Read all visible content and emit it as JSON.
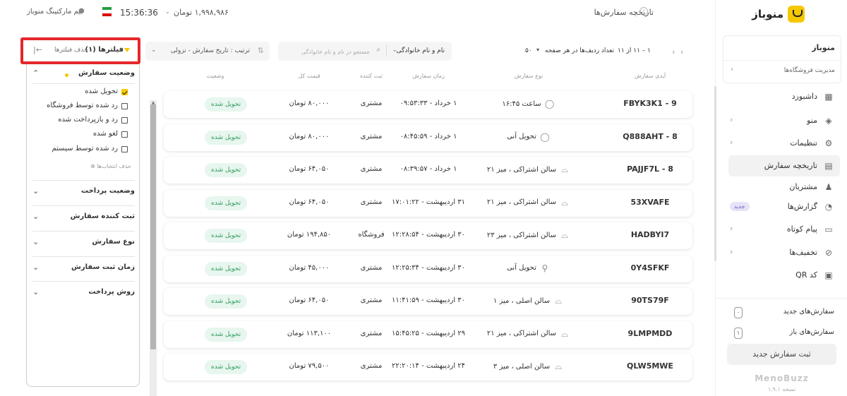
{
  "topbar": {
    "page_title": "تاریخچه سفارش‌ها",
    "balance": "۱,۹۹۸,۹۸۶ تومان",
    "clock": "15:36:36",
    "user": "تیم مارکتینگ منوباز"
  },
  "sidebar": {
    "brand": "منوباز",
    "shop_name": "منوباز",
    "shop_manage": "مدیریت فروشگاه‌ها",
    "items": [
      {
        "label": "داشبورد",
        "icon": "dashboard-icon",
        "glyph": "▦",
        "chevron": false
      },
      {
        "label": "منو",
        "icon": "layers-icon",
        "glyph": "◈",
        "chevron": true
      },
      {
        "label": "تنظیمات",
        "icon": "gear-icon",
        "glyph": "⚙",
        "chevron": true
      },
      {
        "label": "تاریخچه سفارش",
        "icon": "receipt-icon",
        "glyph": "▤",
        "chevron": false,
        "active": true
      },
      {
        "label": "مشتریان",
        "icon": "users-icon",
        "glyph": "♟",
        "chevron": false
      },
      {
        "label": "گزارش‌ها",
        "icon": "chart-icon",
        "glyph": "◔",
        "chevron": false,
        "badge": "جدید"
      },
      {
        "label": "پیام کوتاه",
        "icon": "message-icon",
        "glyph": "▭",
        "chevron": true
      },
      {
        "label": "تخفیف‌ها",
        "icon": "discount-icon",
        "glyph": "⊘",
        "chevron": true
      },
      {
        "label": "کد QR",
        "icon": "qr-icon",
        "glyph": "▣",
        "chevron": false
      }
    ],
    "new_orders_label": "سفارش‌های جدید",
    "new_orders_count": "۰",
    "open_orders_label": "سفارش‌های باز",
    "open_orders_count": "۱",
    "new_order_button": "ثبت سفارش جدید",
    "footer_brand": "MenoBuzz",
    "version": "نسخه ۱.۹.۱"
  },
  "filters": {
    "title": "فیلترها (۱)",
    "clear_all": "حذف فیلترها",
    "sections": [
      {
        "title": "وضعیت سفارش",
        "expanded": true,
        "options": [
          {
            "label": "تحویل شده",
            "checked": true
          },
          {
            "label": "رد شده توسط فروشگاه",
            "checked": false
          },
          {
            "label": "رد و بازپرداخت شده",
            "checked": false
          },
          {
            "label": "لغو شده",
            "checked": false
          },
          {
            "label": "رد شده توسط سیستم",
            "checked": false
          }
        ],
        "clear_selection": "حذف انتخاب‌ها"
      },
      {
        "title": "وضعیت پرداخت",
        "expanded": false
      },
      {
        "title": "ثبت کننده سفارش",
        "expanded": false
      },
      {
        "title": "نوع سفارش",
        "expanded": false
      },
      {
        "title": "زمان ثبت سفارش",
        "expanded": false
      },
      {
        "title": "روش پرداخت",
        "expanded": false
      }
    ]
  },
  "toolbar": {
    "sort_label": "ترتیب : تاریخ سفارش - نزولی",
    "search_type": "نام و نام خانوادگی",
    "search_placeholder": "جستجو در نام و نام خانوادگی",
    "rows_per_page_label": "تعداد ردیف‌ها در هر صفحه",
    "rows_per_page": "۵۰",
    "range": "۱ – ۱۱ از ۱۱"
  },
  "table": {
    "headers": [
      "آیدی سفارش",
      "نوع سفارش",
      "زمان سفارش",
      "ثبت کننده",
      "قیمت کل",
      "وضعیت"
    ],
    "rows": [
      {
        "id": "9 - FBYK3K1",
        "type": "ساعت ۱۶:۴۵",
        "type_icon": "bag-icon",
        "glyph": "◯",
        "time": "۱ خرداد - ۰۹:۵۳:۳۳",
        "by": "مشتری",
        "price": "۸۰,۰۰۰ تومان",
        "status": "تحویل شده"
      },
      {
        "id": "8 - Q888AHT",
        "type": "تحویل آنی",
        "type_icon": "bag-icon",
        "glyph": "◯",
        "time": "۱ خرداد - ۰۸:۴۵:۵۹",
        "by": "مشتری",
        "price": "۸۰,۰۰۰ تومان",
        "status": "تحویل شده"
      },
      {
        "id": "8 - PAJJF7L",
        "type": "سالن اشتراکی ، میز ۲۱",
        "type_icon": "cloche-icon",
        "glyph": "⌓",
        "time": "۱ خرداد - ۰۸:۳۹:۵۷",
        "by": "مشتری",
        "price": "۶۴,۰۵۰ تومان",
        "status": "تحویل شده"
      },
      {
        "id": "53XVAFE",
        "type": "سالن اشتراکی ، میز ۲۱",
        "type_icon": "cloche-icon",
        "glyph": "⌓",
        "time": "۳۱ اردیبهشت - ۱۷:۰۱:۲۲",
        "by": "مشتری",
        "price": "۶۴,۰۵۰ تومان",
        "status": "تحویل شده"
      },
      {
        "id": "HADBYI7",
        "type": "سالن اشتراکی ، میز ۲۳",
        "type_icon": "cloche-icon",
        "glyph": "⌓",
        "time": "۳۰ اردیبهشت - ۱۲:۲۸:۵۴",
        "by": "فروشگاه",
        "price": "۱۹۴,۸۵۰ تومان",
        "status": "تحویل شده"
      },
      {
        "id": "0Y4SFKF",
        "type": "تحویل آنی",
        "type_icon": "scooter-icon",
        "glyph": "⚲",
        "time": "۳۰ اردیبهشت - ۱۲:۲۵:۳۴",
        "by": "مشتری",
        "price": "۴۵,۰۰۰ تومان",
        "status": "تحویل شده"
      },
      {
        "id": "90TS79F",
        "type": "سالن اصلی ، میز ۱",
        "type_icon": "cloche-icon",
        "glyph": "⌓",
        "time": "۳۰ اردیبهشت - ۱۱:۴۱:۵۹",
        "by": "مشتری",
        "price": "۶۴,۰۵۰ تومان",
        "status": "تحویل شده"
      },
      {
        "id": "9LMPMDD",
        "type": "سالن اشتراکی ، میز ۲۱",
        "type_icon": "cloche-icon",
        "glyph": "⌓",
        "time": "۲۹ اردیبهشت - ۱۵:۴۵:۲۵",
        "by": "مشتری",
        "price": "۱۱۳,۱۰۰ تومان",
        "status": "تحویل شده"
      },
      {
        "id": "QLW5MWE",
        "type": "سالن اصلی ، میز ۳",
        "type_icon": "cloche-icon",
        "glyph": "⌓",
        "time": "۲۴ اردیبهشت - ۲۲:۲۰:۱۴",
        "by": "مشتری",
        "price": "۷۹,۵۰۰ تومان",
        "status": "تحویل شده"
      }
    ]
  },
  "colors": {
    "accent": "#f5c800",
    "highlight": "#e5262b",
    "status_bg": "#e7f6ee",
    "status_fg": "#2f9b5b"
  }
}
